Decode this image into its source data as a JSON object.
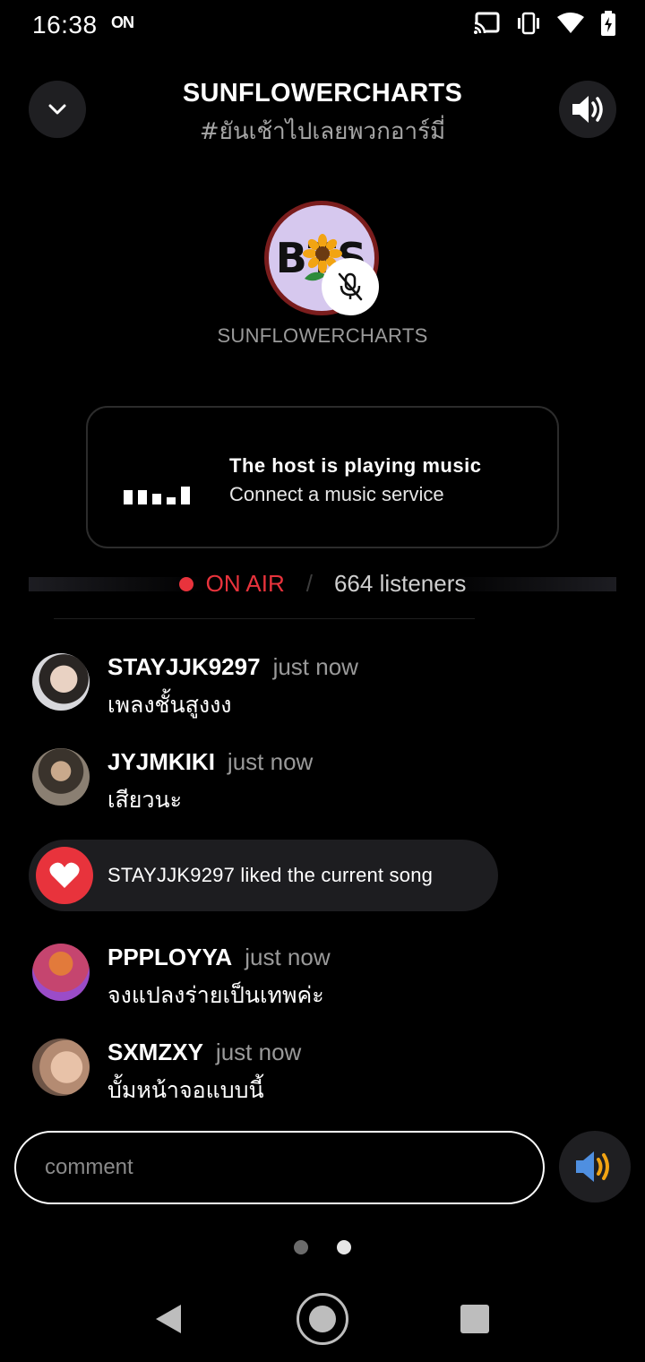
{
  "status_bar": {
    "time": "16:38",
    "on_badge": "ON",
    "icons": [
      "cast-icon",
      "vibrate-icon",
      "wifi-icon",
      "battery-charging-icon"
    ]
  },
  "header": {
    "title": "SUNFLOWERCHARTS",
    "subtitle": "#ยันเช้าไปเลยพวกอาร์มี่",
    "collapse_icon": "chevron-down-icon",
    "volume_icon": "volume-icon"
  },
  "host": {
    "avatar_text": "BTS",
    "name": "SUNFLOWERCHARTS",
    "muted": true
  },
  "music_card": {
    "title": "The host is playing music",
    "subtitle": "Connect a music service"
  },
  "on_air": {
    "label": "ON AIR",
    "separator": "/",
    "listeners": "664 listeners"
  },
  "comments": [
    {
      "user": "STAYJJK9297",
      "time": "just now",
      "text": "เพลงชั้นสูงงง"
    },
    {
      "user": "JYJMKIKI",
      "time": "just now",
      "text": "เสียวนะ"
    },
    {
      "user": "PPPLOYYA",
      "time": "just now",
      "text": "จงแปลงร่ายเป็นเทพค่ะ"
    },
    {
      "user": "SXMZXY",
      "time": "just now",
      "text": "บั้มหน้าจอแบบนี้"
    }
  ],
  "like_event": {
    "text": "STAYJJK9297 liked the current song"
  },
  "composer": {
    "placeholder": "comment"
  },
  "colors": {
    "accent_red": "#e8333c",
    "background": "#000000",
    "pill_bg": "#1d1d20"
  }
}
